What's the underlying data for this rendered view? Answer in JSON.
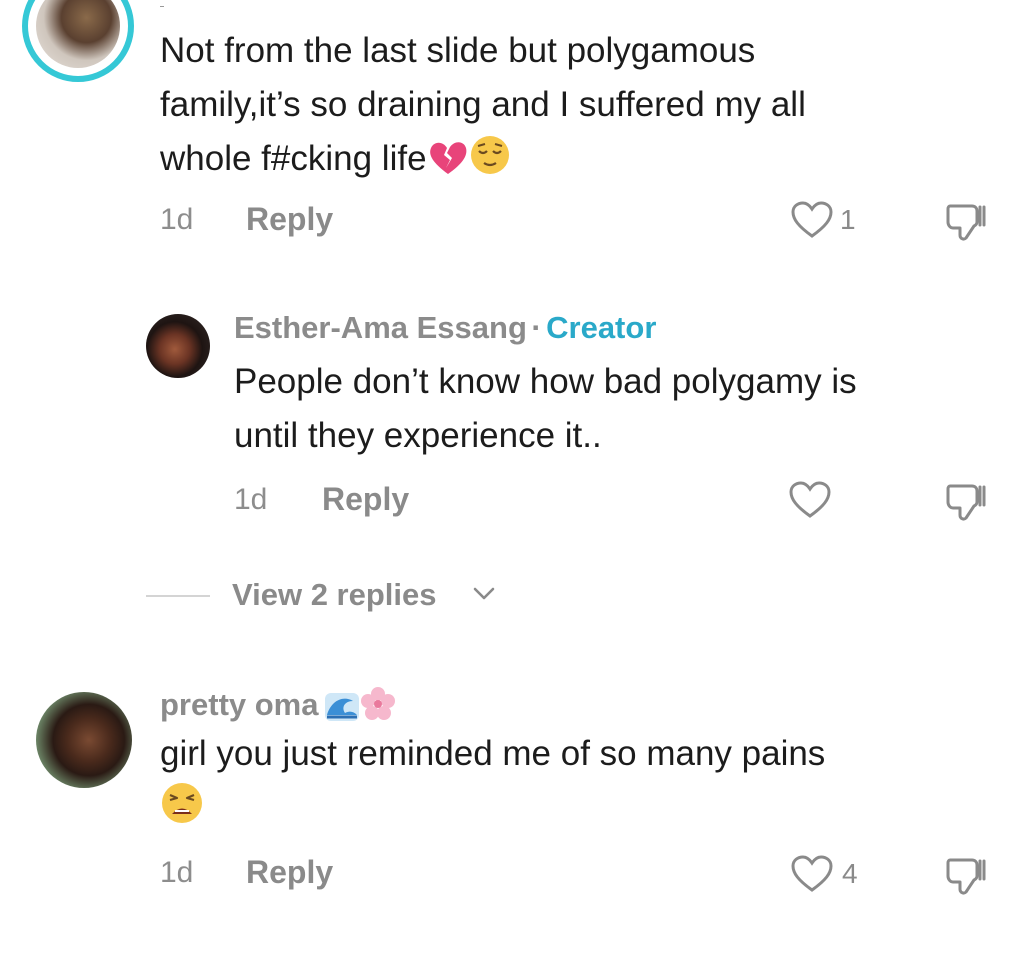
{
  "comments": [
    {
      "text_line1": "Not from the last slide but polygamous",
      "text_line2": "family,it’s so draining and I suffered my all",
      "text_line3": "whole f#cking life",
      "emoji_names": [
        "broken-heart-icon",
        "relieved-face-icon"
      ],
      "time": "1d",
      "reply_label": "Reply",
      "like_count": "1"
    },
    {
      "username": "Esther-Ama Essang",
      "separator": "·",
      "badge": "Creator",
      "text_line1": "People don’t know how bad polygamy is",
      "text_line2": "until they experience it..",
      "time": "1d",
      "reply_label": "Reply",
      "like_count": ""
    },
    {
      "username": "pretty oma",
      "username_emojis": [
        "wave-icon",
        "cherry-blossom-icon"
      ],
      "text_line1": "girl you just reminded me of so many pains",
      "emoji_names": [
        "weary-face-icon"
      ],
      "time": "1d",
      "reply_label": "Reply",
      "like_count": "4"
    }
  ],
  "view_replies": {
    "label": "View 2 replies",
    "icon": "chevron-down-icon"
  },
  "colors": {
    "creator_badge": "#2aa9c9",
    "muted_text": "#8b8b8b",
    "primary_text": "#1c1c1c",
    "story_ring": "#35c8d6"
  }
}
